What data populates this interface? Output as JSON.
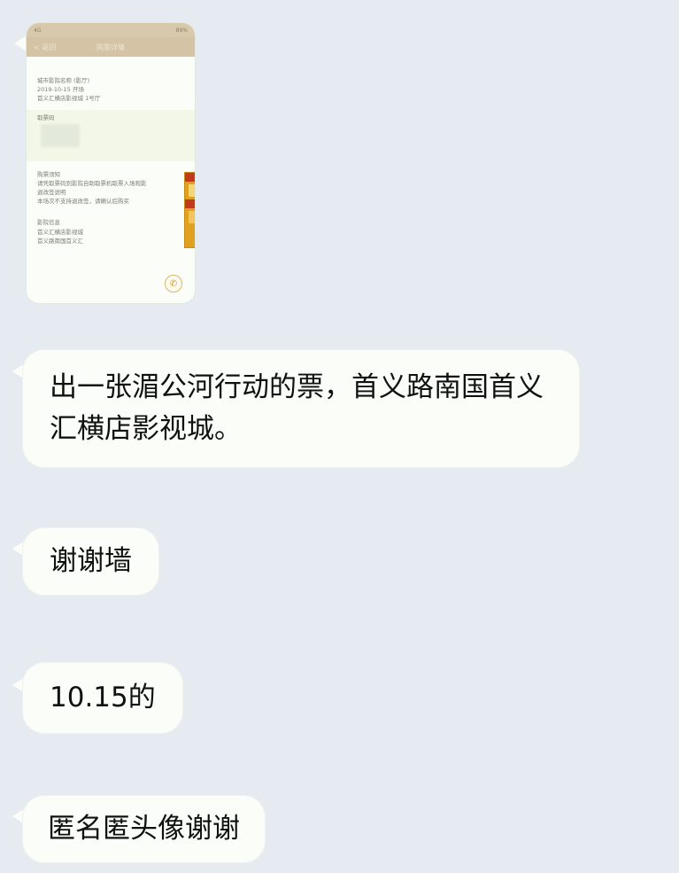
{
  "messages": [
    {
      "type": "image",
      "screenshot": {
        "status_bar": {
          "left": "4G",
          "right": "89%"
        },
        "nav": {
          "back": "< 返回",
          "title": "购票详情"
        },
        "cinema_line": "城市影院名称 (影厅)",
        "info_line1": "2019-10-15 开场",
        "info_line2": "首义汇横店影视城 1号厅",
        "code_label": "取票码",
        "notice_title": "购票须知",
        "notice_text": "请凭取票码到影院自助取票机取票入场观影",
        "notice2_title": "退改签说明",
        "notice2_text": "本场次不支持退改签，请确认后购买",
        "contact_title": "影院信息",
        "contact_line1": "首义汇横店影视城",
        "contact_line2": "首义路南国首义汇",
        "call_icon": "phone-icon"
      }
    },
    {
      "type": "text",
      "text": "出一张湄公河行动的票，首义路南国首义汇横店影视城。"
    },
    {
      "type": "text",
      "text": "谢谢墙"
    },
    {
      "type": "text",
      "text": "10.15的"
    },
    {
      "type": "text",
      "text": "匿名匿头像谢谢"
    }
  ]
}
